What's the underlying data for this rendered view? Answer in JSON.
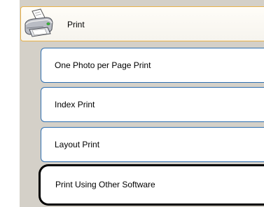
{
  "header": {
    "title": "Print",
    "icon": "printer-icon"
  },
  "menu": {
    "items": [
      {
        "label": "One Photo per Page Print"
      },
      {
        "label": "Index Print"
      },
      {
        "label": "Layout Print"
      },
      {
        "label": "Print Using Other Software",
        "selected": true
      }
    ]
  },
  "colors": {
    "panel_background": "#d4d0c8",
    "header_border": "#e8b24a",
    "item_border": "#2f6fb0",
    "selection_outline": "#000000"
  }
}
